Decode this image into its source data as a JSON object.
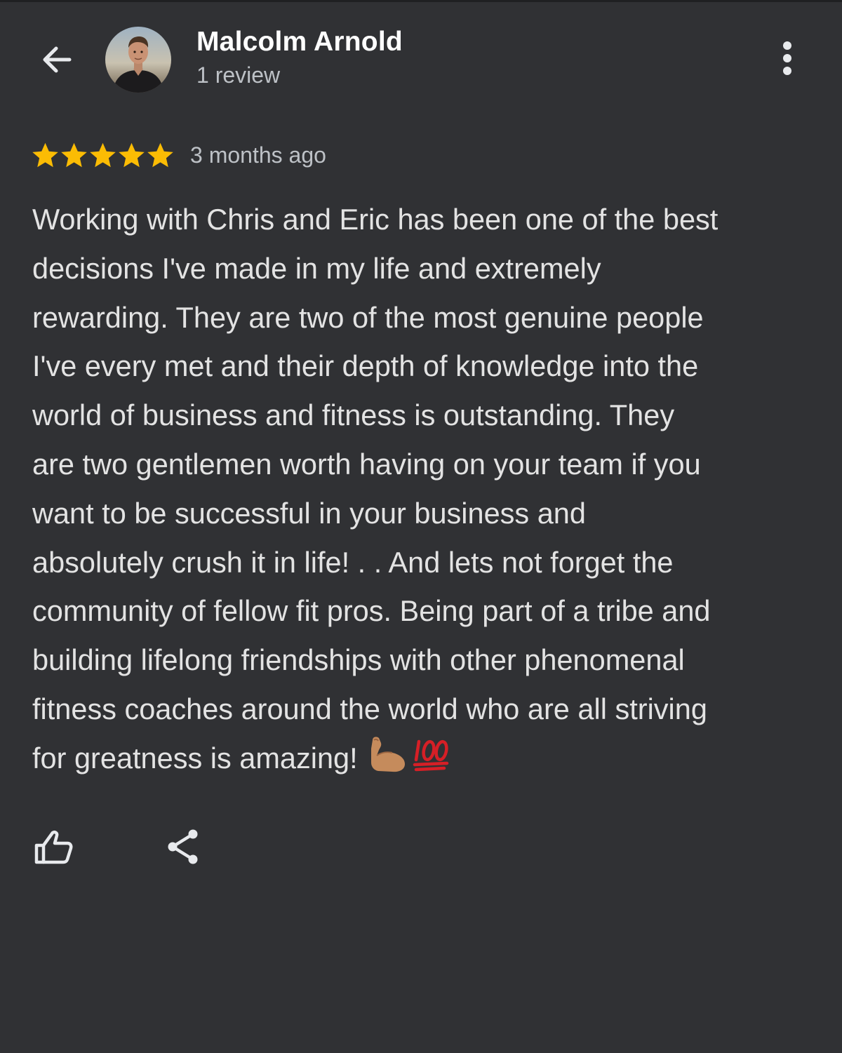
{
  "header": {
    "reviewer_name": "Malcolm Arnold",
    "review_count": "1 review",
    "back_icon": "arrow-back-icon",
    "more_icon": "more-vertical-icon"
  },
  "review": {
    "rating": 5,
    "rating_max": 5,
    "time_ago": "3 months ago",
    "lines": [
      "Working with Chris and Eric has been one of the best",
      "decisions I've made in my life and extremely",
      "rewarding. They are two of the most genuine people",
      "I've every met and their depth of knowledge into the",
      "world of business and fitness is outstanding. They",
      "are two gentlemen worth having on your team if you",
      "want to be successful in your business and",
      "absolutely crush it in life! . . And lets not forget the",
      "community of fellow fit pros. Being part of a tribe and",
      "building lifelong friendships with other phenomenal",
      "fitness coaches around the world who are all striving",
      "for greatness is amazing!"
    ],
    "emojis": [
      "flexed-biceps-emoji",
      "hundred-points-emoji"
    ]
  },
  "actions": {
    "like_icon": "thumbs-up-icon",
    "share_icon": "share-icon"
  },
  "colors": {
    "background": "#303134",
    "star": "#fbbc04",
    "primary_text": "#ffffff",
    "secondary_text": "#bdc1c6",
    "body_text": "#e3e3e3"
  }
}
